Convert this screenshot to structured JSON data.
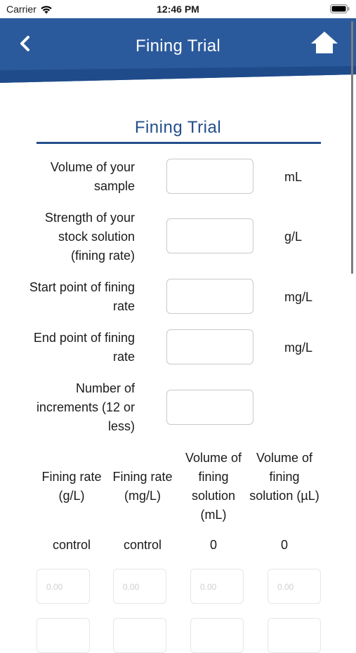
{
  "status_bar": {
    "carrier": "Carrier",
    "time": "12:46 PM"
  },
  "nav": {
    "title": "Fining Trial",
    "back_icon": "chevron-left-icon",
    "home_icon": "home-icon",
    "color": "#2b5a9c"
  },
  "section": {
    "title": "Fining Trial",
    "accent": "#234e8c"
  },
  "fields": [
    {
      "label": "Volume of your sample",
      "value": "",
      "unit": "mL"
    },
    {
      "label": "Strength of your stock solution (fining rate)",
      "value": "",
      "unit": "g/L"
    },
    {
      "label": "Start point of fining rate",
      "value": "",
      "unit": "mg/L"
    },
    {
      "label": "End point of fining rate",
      "value": "",
      "unit": "mg/L"
    },
    {
      "label": "Number of increments (12 or less)",
      "value": "",
      "unit": ""
    }
  ],
  "table": {
    "headers": [
      "Fining rate (g/L)",
      "Fining rate (mg/L)",
      "Volume of fining solution (mL)",
      "Volume of fining solution (µL)"
    ],
    "control_row": [
      "control",
      "control",
      "0",
      "0"
    ],
    "rows": [
      [
        "0.00",
        "0.00",
        "0.00",
        "0.00"
      ],
      [
        "",
        "",
        "",
        ""
      ]
    ]
  }
}
